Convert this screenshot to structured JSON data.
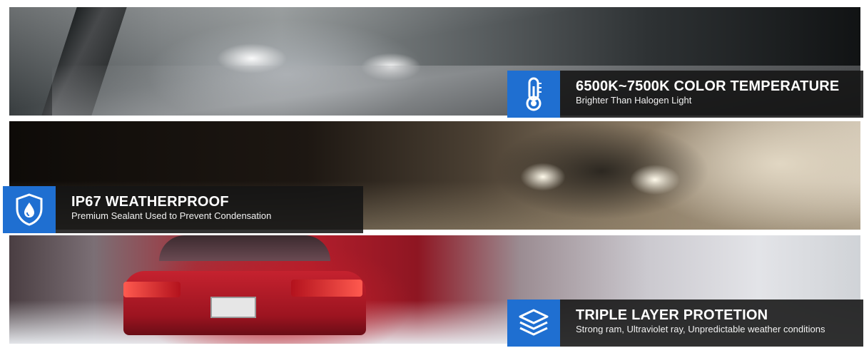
{
  "features": [
    {
      "title": "6500K~7500K COLOR TEMPERATURE",
      "subtitle": "Brighter Than Halogen Light",
      "icon": "thermometer-icon"
    },
    {
      "title": "IP67 WEATHERPROOF",
      "subtitle": "Premium Sealant Used to Prevent Condensation",
      "icon": "shield-water-icon"
    },
    {
      "title": "TRIPLE LAYER PROTETION",
      "subtitle": "Strong ram, Ultraviolet ray, Unpredictable weather conditions",
      "icon": "layers-icon"
    }
  ],
  "colors": {
    "accent": "#1f6fd1",
    "caption_bg": "#141414",
    "text": "#ffffff"
  }
}
